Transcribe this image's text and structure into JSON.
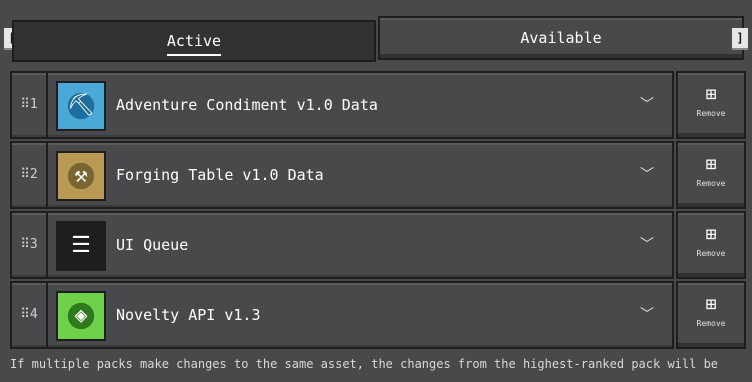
{
  "tabs": {
    "left_bracket": "[",
    "right_bracket": "]",
    "active_label": "Active",
    "available_label": "Available"
  },
  "packs": [
    {
      "rank": "⠿1",
      "name": "Adventure Condiment v1.0 Data",
      "icon": "pickaxe-icon",
      "remove_label": "Remove"
    },
    {
      "rank": "⠿2",
      "name": "Forging Table v1.0 Data",
      "icon": "hammer-icon",
      "remove_label": "Remove"
    },
    {
      "rank": "⠿3",
      "name": "UI Queue",
      "icon": "stack-icon",
      "remove_label": "Remove"
    },
    {
      "rank": "⠿4",
      "name": "Novelty API v1.3",
      "icon": "gem-icon",
      "remove_label": "Remove"
    }
  ],
  "footer_text": "If multiple packs make changes to the same asset, the changes from the highest-ranked pack will be"
}
